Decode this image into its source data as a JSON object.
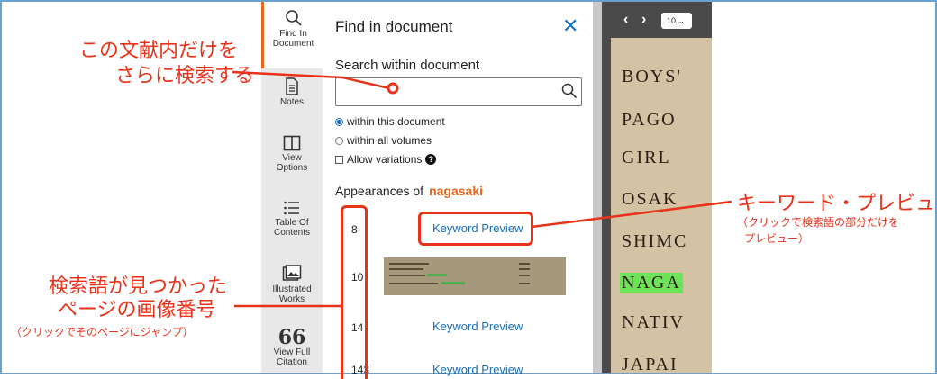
{
  "rail": {
    "items": [
      {
        "line1": "Find In",
        "line2": "Document"
      },
      {
        "line1": "Notes",
        "line2": ""
      },
      {
        "line1": "View",
        "line2": "Options"
      },
      {
        "line1": "Table Of",
        "line2": "Contents"
      },
      {
        "line1": "Illustrated",
        "line2": "Works"
      },
      {
        "line1": "View Full",
        "line2": "Citation"
      }
    ]
  },
  "panel": {
    "title": "Find in document",
    "close": "✕",
    "search_label": "Search within document",
    "search_value": "",
    "options": {
      "within_doc": "within this document",
      "within_all": "within all volumes",
      "allow_var": "Allow variations"
    },
    "appearances_label": "Appearances of",
    "keyword": "nagasaki",
    "results": [
      {
        "page": "8",
        "link": "Keyword Preview"
      },
      {
        "page": "10",
        "link": ""
      },
      {
        "page": "14",
        "link": "Keyword Preview"
      },
      {
        "page": "143",
        "link": "Keyword Preview"
      }
    ]
  },
  "viewer": {
    "page_select": "10 ⌄",
    "prev": "‹",
    "next": "›",
    "words": [
      "BOYS'",
      "PAGO",
      "GIRL",
      "OSAK",
      "SHIMC",
      "NAGA",
      "NATIV",
      "JAPAI"
    ]
  },
  "annotations": {
    "a1_line1": "この文献内だけを",
    "a1_line2": "さらに検索する",
    "a2_main": "キーワード・プレビュー",
    "a2_sub1": "（クリックで検索語の部分だけを",
    "a2_sub2": "プレビュー）",
    "a3_line1": "検索語が見つかった",
    "a3_line2": "ページの画像番号",
    "a3_sub": "（クリックでそのページにジャンプ）"
  },
  "colors": {
    "accent_red": "#e8321a",
    "link_blue": "#1a6fb7",
    "keyword_orange": "#e8641a",
    "highlight_green": "#6ee35a"
  }
}
